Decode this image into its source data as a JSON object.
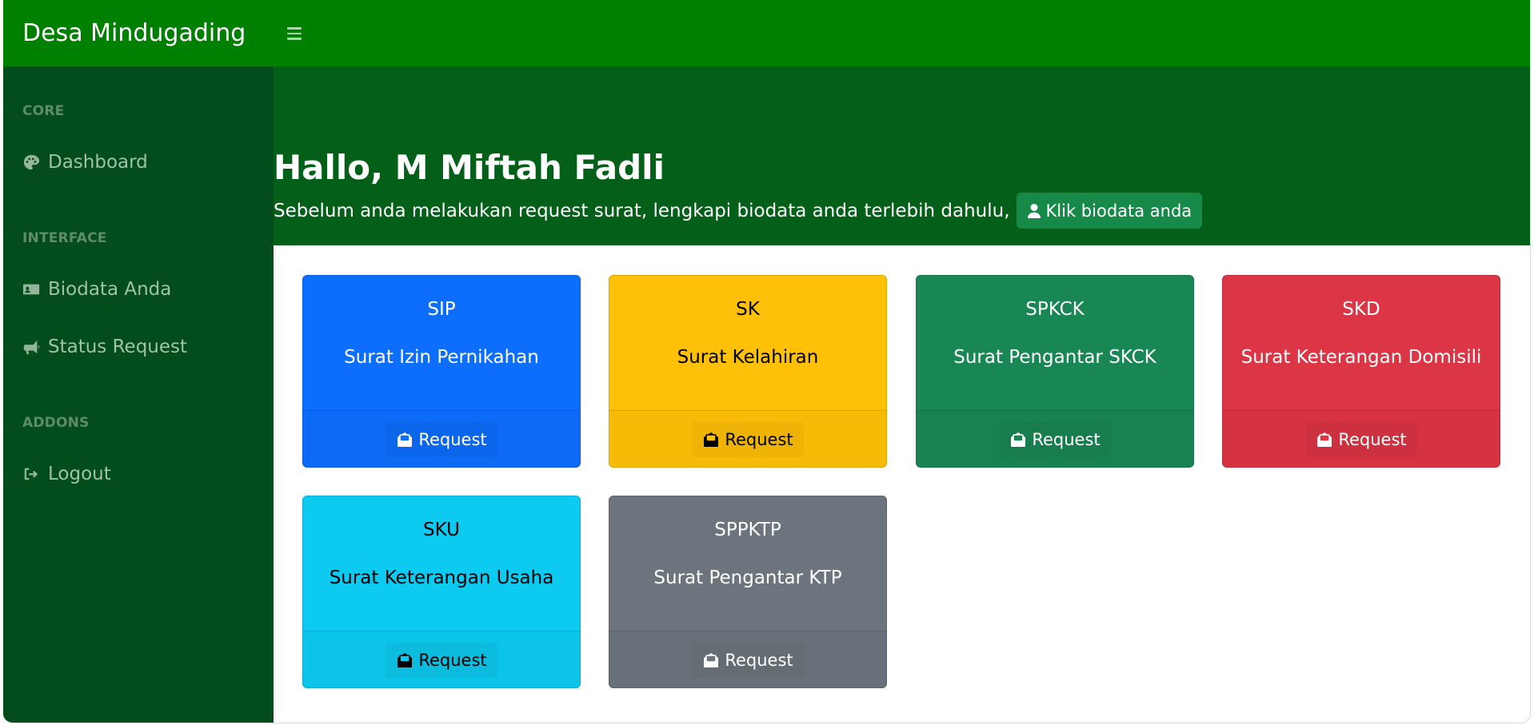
{
  "app": {
    "brand": "Desa Mindugading"
  },
  "sidebar": {
    "sections": [
      {
        "heading": "CORE",
        "items": [
          {
            "label": "Dashboard",
            "icon": "palette-icon"
          }
        ]
      },
      {
        "heading": "INTERFACE",
        "items": [
          {
            "label": "Biodata Anda",
            "icon": "id-card-icon"
          },
          {
            "label": "Status Request",
            "icon": "bullhorn-icon"
          }
        ]
      },
      {
        "heading": "ADDONS",
        "items": [
          {
            "label": "Logout",
            "icon": "sign-out-icon"
          }
        ]
      }
    ]
  },
  "hero": {
    "greeting": "Hallo, M Miftah Fadli",
    "subtitle": "Sebelum anda melakukan request surat, lengkapi biodata anda terlebih dahulu,",
    "biodata_button": "Klik biodata anda"
  },
  "cards": [
    {
      "code": "SIP",
      "name": "Surat Izin Pernikahan",
      "button": "Request",
      "color": "#0d6efd",
      "text_color": "#ffffff"
    },
    {
      "code": "SK",
      "name": "Surat Kelahiran",
      "button": "Request",
      "color": "#ffc107",
      "text_color": "#000000"
    },
    {
      "code": "SPKCK",
      "name": "Surat Pengantar SKCK",
      "button": "Request",
      "color": "#198754",
      "text_color": "#ffffff"
    },
    {
      "code": "SKD",
      "name": "Surat Keterangan Domisili",
      "button": "Request",
      "color": "#dc3545",
      "text_color": "#ffffff"
    },
    {
      "code": "SKU",
      "name": "Surat Keterangan Usaha",
      "button": "Request",
      "color": "#0dcaf0",
      "text_color": "#000000"
    },
    {
      "code": "SPPKTP",
      "name": "Surat Pengantar KTP",
      "button": "Request",
      "color": "#6c757d",
      "text_color": "#ffffff"
    }
  ],
  "colors": {
    "topbar": "#008000",
    "sidebar": "#024d1b",
    "hero": "#045f19",
    "sidebar_text": "#a0c2a6",
    "sidebar_heading": "#5e8b68"
  }
}
